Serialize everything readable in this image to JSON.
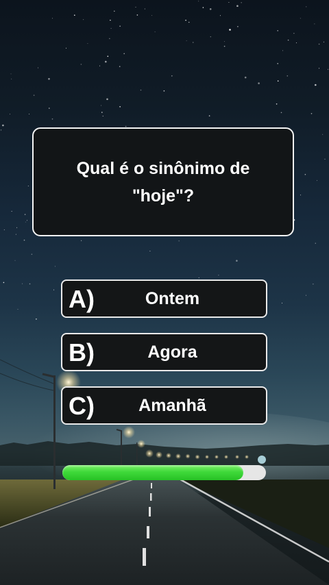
{
  "quiz": {
    "question": "Qual é o sinônimo de\n\"hoje\"?",
    "options": [
      {
        "letter": "A)",
        "text": "Ontem"
      },
      {
        "letter": "B)",
        "text": "Agora"
      },
      {
        "letter": "C)",
        "text": "Amanhã"
      }
    ],
    "timer_progress": 0.89
  },
  "colors": {
    "card_background": "#121517",
    "card_border": "#f4f4f4",
    "timer_fill": "#3fd93a",
    "timer_track": "#e6e6e6"
  },
  "icons": {
    "background": "night-sky-road-illustration"
  }
}
